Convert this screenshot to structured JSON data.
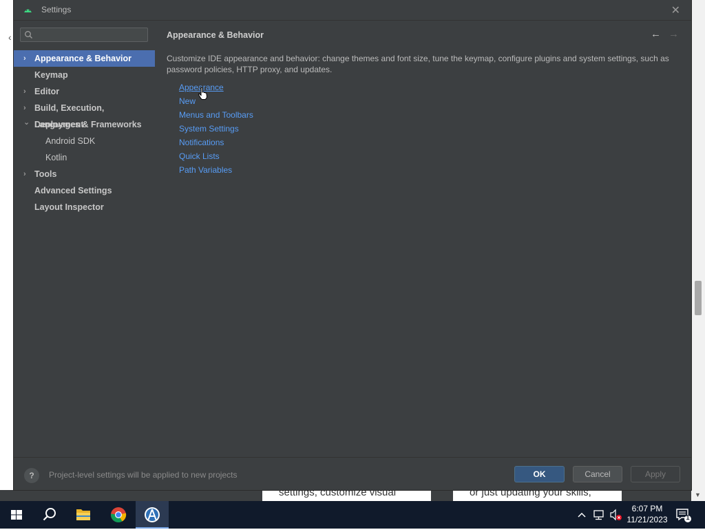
{
  "background": {
    "card_texts": [
      "settings, customize visual",
      "or just updating your skills,"
    ]
  },
  "dialog": {
    "title": "Settings",
    "search": {
      "value": "",
      "placeholder": ""
    },
    "sidebar": {
      "items": [
        {
          "label": "Appearance & Behavior",
          "chevron": "›",
          "selected": true
        },
        {
          "label": "Keymap",
          "chevron": ""
        },
        {
          "label": "Editor",
          "chevron": "›"
        },
        {
          "label": "Build, Execution, Deployment",
          "chevron": "›"
        },
        {
          "label": "Languages & Frameworks",
          "chevron": "⌄"
        },
        {
          "label": "Android SDK",
          "chevron": "",
          "sub": true
        },
        {
          "label": "Kotlin",
          "chevron": "",
          "sub": true
        },
        {
          "label": "Tools",
          "chevron": "›"
        },
        {
          "label": "Advanced Settings",
          "chevron": ""
        },
        {
          "label": "Layout Inspector",
          "chevron": ""
        }
      ]
    },
    "content": {
      "heading": "Appearance & Behavior",
      "back_icon": "←",
      "forward_icon": "→",
      "description": "Customize IDE appearance and behavior: change themes and font size, tune the keymap, configure plugins and system settings, such as password policies, HTTP proxy, and updates.",
      "links": [
        {
          "label": "Appearance",
          "hover": true
        },
        {
          "label": "New"
        },
        {
          "label": "Menus and Toolbars"
        },
        {
          "label": "System Settings"
        },
        {
          "label": "Notifications"
        },
        {
          "label": "Quick Lists"
        },
        {
          "label": "Path Variables"
        }
      ]
    },
    "footer": {
      "help_label": "?",
      "note": "Project-level settings will be applied to new projects",
      "ok_label": "OK",
      "cancel_label": "Cancel",
      "apply_label": "Apply"
    },
    "close_icon": "✕"
  },
  "taskbar": {
    "time": "6:07 PM",
    "date": "11/21/2023",
    "notification_count": "1",
    "icons": [
      "windows-start-icon",
      "search-icon",
      "file-explorer-icon",
      "chrome-icon",
      "android-studio-icon"
    ]
  },
  "colors": {
    "dialog_bg": "#3c3f41",
    "selection": "#4b6eaf",
    "link": "#589df6",
    "ok_button": "#365880",
    "taskbar": "#101a2b"
  }
}
